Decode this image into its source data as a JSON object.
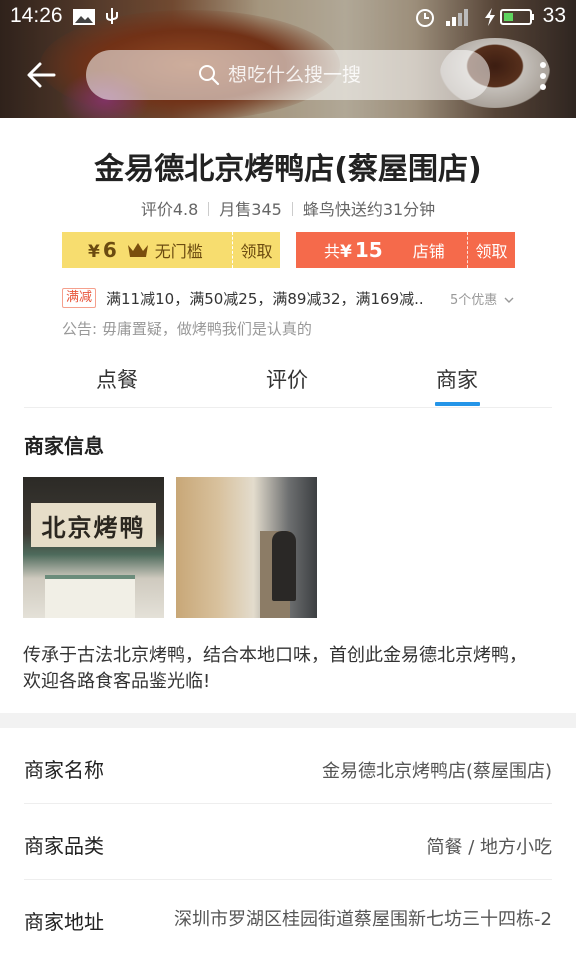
{
  "status_bar": {
    "time": "14:26",
    "battery": "33"
  },
  "search": {
    "placeholder": "想吃什么搜一搜"
  },
  "store": {
    "name": "金易德北京烤鸭店(蔡屋围店)",
    "rating": "评价4.8",
    "monthly_sales": "月售345",
    "delivery": "蜂鸟快送约31分钟"
  },
  "coupons": [
    {
      "yen": "¥",
      "amount": "6",
      "desc": "无门槛",
      "claim": "领取",
      "color": "#f7dd6f"
    },
    {
      "prefix": "共",
      "yen": "¥",
      "amount": "15",
      "desc": "店铺",
      "claim": "领取",
      "color": "#f56a4b"
    }
  ],
  "promo": {
    "tag": "满减",
    "text": "满11减10，满50减25，满89减32，满169减..",
    "more": "5个优惠"
  },
  "notice": "公告: 毋庸置疑，做烤鸭我们是认真的",
  "tabs": [
    {
      "label": "点餐"
    },
    {
      "label": "评价"
    },
    {
      "label": "商家",
      "active": true
    }
  ],
  "accent_color": "#2495e8",
  "merchant": {
    "section_title": "商家信息",
    "photo_sign": "北京烤鸭",
    "description": "传承于古法北京烤鸭，结合本地口味，首创此金易德北京烤鸭，欢迎各路食客品鉴光临!",
    "rows": [
      {
        "label": "商家名称",
        "value": "金易德北京烤鸭店(蔡屋围店)"
      },
      {
        "label": "商家品类",
        "value": "简餐 / 地方小吃"
      },
      {
        "label": "商家地址",
        "value": "深圳市罗湖区桂园街道蔡屋围新七坊三十四栋-2"
      }
    ]
  }
}
